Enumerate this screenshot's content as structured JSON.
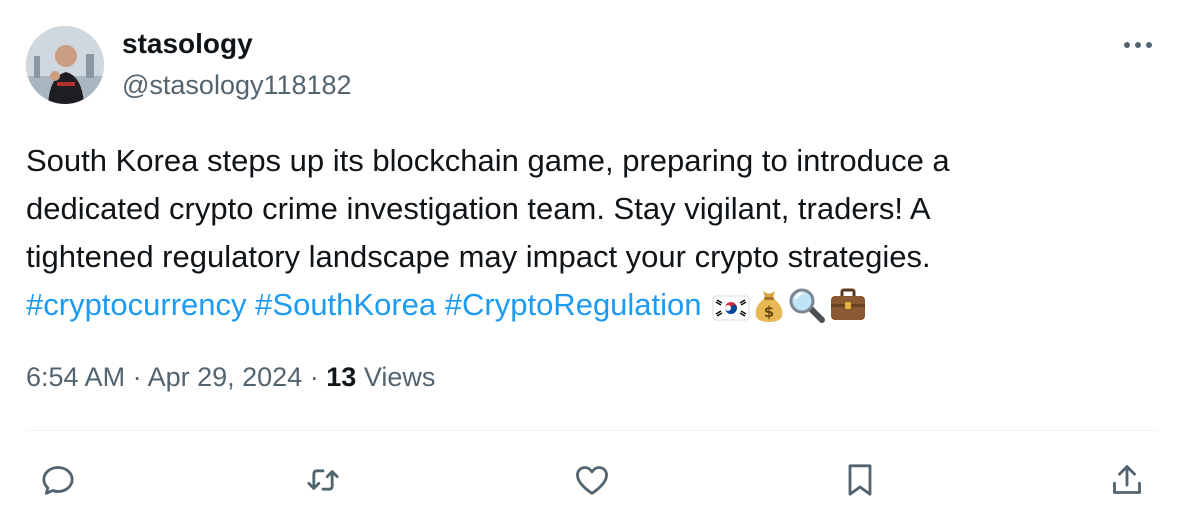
{
  "tweet": {
    "author": {
      "display_name": "stasology",
      "handle": "@stasology118182"
    },
    "text_lines": [
      "South Korea steps up its blockchain game, preparing to introduce a",
      "dedicated crypto crime investigation team. Stay vigilant, traders! A",
      "tightened regulatory landscape may impact your crypto strategies."
    ],
    "hashtags": [
      "#cryptocurrency",
      "#SouthKorea",
      "#CryptoRegulation"
    ],
    "emojis": [
      "south-korea-flag-icon",
      "money-bag-icon",
      "magnifying-glass-icon",
      "briefcase-icon"
    ],
    "time": "6:54 AM",
    "separator": "·",
    "date": "Apr 29, 2024",
    "views_count": "13",
    "views_label": "Views"
  },
  "colors": {
    "text": "#0f1419",
    "secondary": "#536471",
    "link": "#1d9bf0",
    "divider": "#eff3f4"
  },
  "actions": [
    "reply-icon",
    "retweet-icon",
    "like-icon",
    "bookmark-icon",
    "share-icon"
  ]
}
